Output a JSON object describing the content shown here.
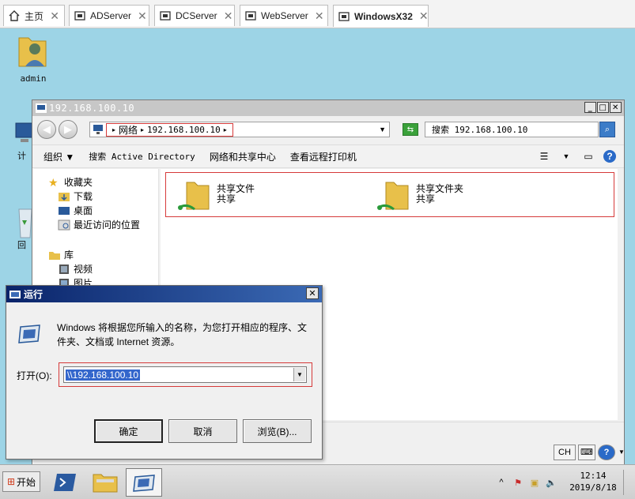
{
  "vm_tabs": [
    {
      "label": "主页",
      "icon": "home-icon",
      "active": false
    },
    {
      "label": "ADServer",
      "icon": "vm-icon",
      "active": false
    },
    {
      "label": "DCServer",
      "icon": "vm-icon",
      "active": false
    },
    {
      "label": "WebServer",
      "icon": "vm-icon",
      "active": false
    },
    {
      "label": "WindowsX32",
      "icon": "vm-icon",
      "active": true
    }
  ],
  "desktop": {
    "icons": [
      {
        "label": "admin",
        "icon": "user-folder-icon"
      },
      {
        "label": "计",
        "icon": "computer-icon"
      },
      {
        "label": "回",
        "icon": "recycle-bin-icon"
      }
    ]
  },
  "explorer": {
    "title": "192.168.100.10",
    "address": {
      "crumbs": [
        "网络",
        "192.168.100.10"
      ]
    },
    "search_placeholder": "搜索 192.168.100.10",
    "toolbar": {
      "organize": "组织 ▼",
      "search_ad": "搜索 Active Directory",
      "network_center": "网络和共享中心",
      "printers": "查看远程打印机"
    },
    "nav": {
      "favorites": "收藏夹",
      "downloads": "下载",
      "desktop": "桌面",
      "recent": "最近访问的位置",
      "libraries": "库",
      "videos": "视频",
      "pictures": "图片"
    },
    "shares": [
      {
        "name": "共享文件",
        "type": "共享"
      },
      {
        "name": "共享文件夹",
        "type": "共享"
      }
    ]
  },
  "run_dialog": {
    "title": "运行",
    "description": "Windows 将根据您所输入的名称，为您打开相应的程序、文件夹、文档或 Internet 资源。",
    "open_label": "打开(O):",
    "value": "\\\\192.168.100.10",
    "buttons": {
      "ok": "确定",
      "cancel": "取消",
      "browse": "浏览(B)..."
    }
  },
  "langbar": {
    "lang": "CH"
  },
  "taskbar": {
    "start_label": "开始",
    "clock_time": "12:14",
    "clock_date": "2019/8/18"
  },
  "colors": {
    "desktop": "#9dd4e6",
    "highlight_red": "#d63a3a",
    "run_titlebar": "#0a246a"
  }
}
